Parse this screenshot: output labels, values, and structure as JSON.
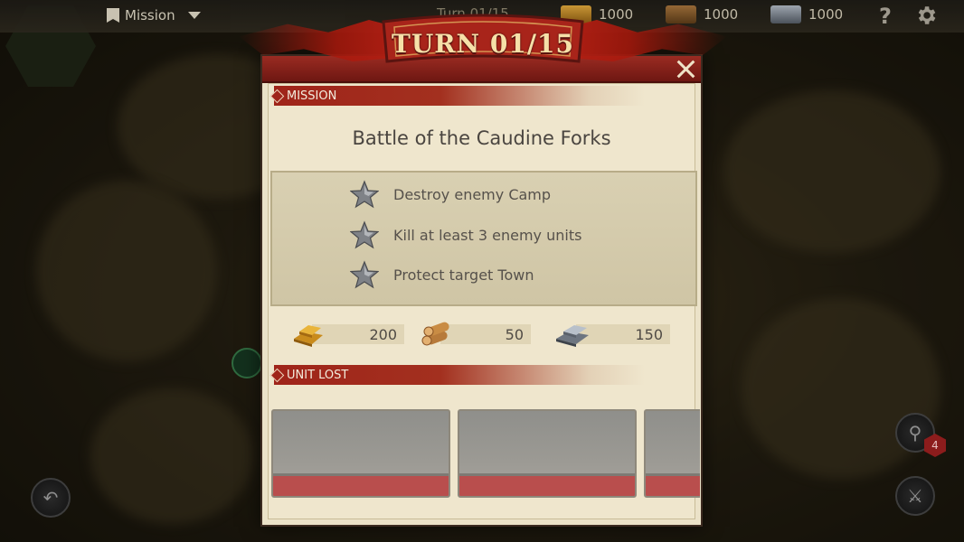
{
  "topbar": {
    "mission_label": "Mission",
    "turn_label": "Turn 01/15",
    "resources": [
      {
        "icon": "gold-icon",
        "value": "1000"
      },
      {
        "icon": "wood-icon",
        "value": "1000"
      },
      {
        "icon": "iron-icon",
        "value": "1000"
      }
    ]
  },
  "banner": {
    "turn_text": "TURN 01/15"
  },
  "dialog": {
    "mission_section": "MISSION",
    "title": "Battle of the Caudine Forks",
    "objectives": [
      "Destroy enemy Camp",
      "Kill at least 3 enemy units",
      "Protect target Town"
    ],
    "rewards": [
      {
        "icon": "gold-bars-icon",
        "value": "200"
      },
      {
        "icon": "wood-logs-icon",
        "value": "50"
      },
      {
        "icon": "iron-ingots-icon",
        "value": "150"
      }
    ],
    "unit_lost_section": "UNIT LOST",
    "unit_slots": 3
  },
  "side": {
    "badge_count": "4"
  },
  "colors": {
    "accent_red": "#9f2419",
    "parchment": "#ebe2c8",
    "banner_gold": "#f6e0a8"
  }
}
